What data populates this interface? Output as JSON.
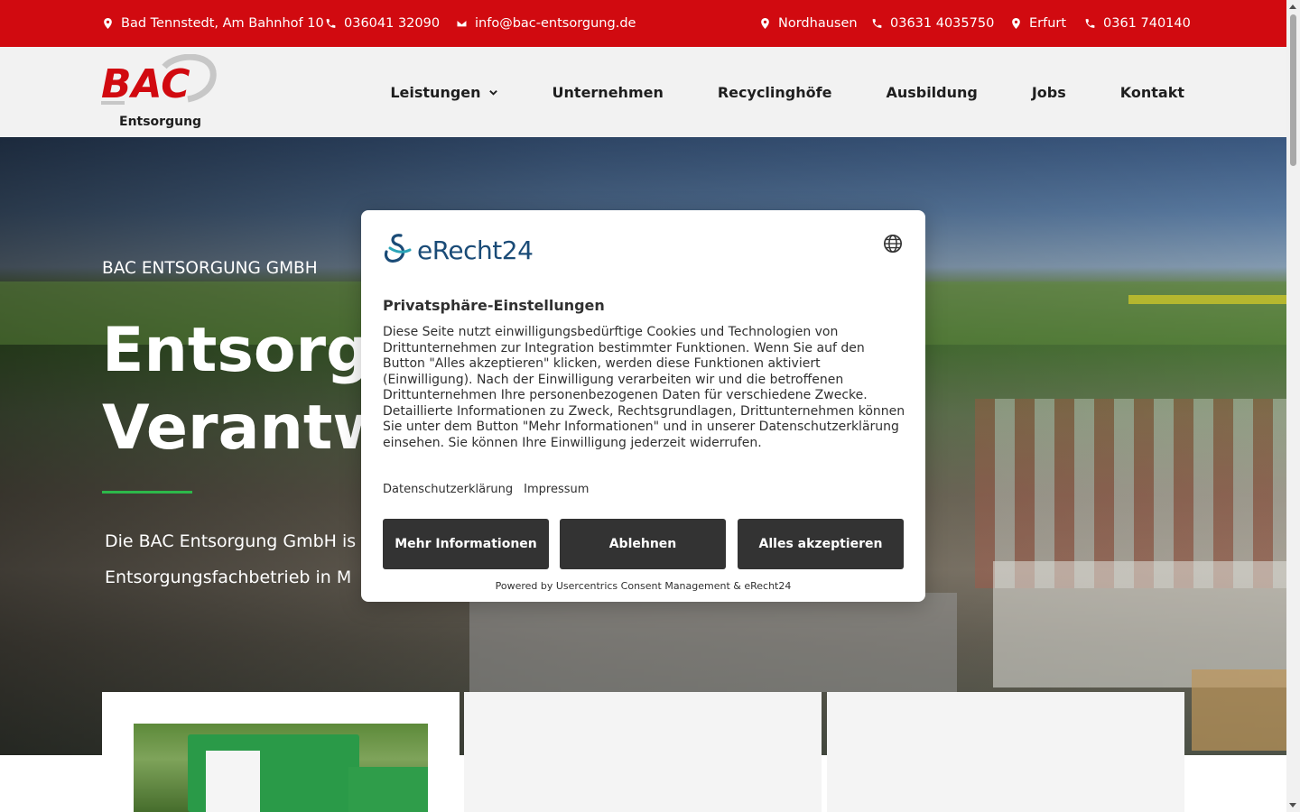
{
  "topbar": {
    "items": [
      {
        "icon": "map-pin-icon",
        "text": "Bad Tennstedt, Am Bahnhof 10"
      },
      {
        "icon": "phone-icon",
        "text": "036041 32090"
      },
      {
        "icon": "mail-icon",
        "text": "info@bac-entsorgung.de"
      },
      {
        "icon": "map-pin-icon",
        "text": "Nordhausen"
      },
      {
        "icon": "phone-icon",
        "text": "03631 4035750"
      },
      {
        "icon": "map-pin-icon",
        "text": "Erfurt"
      },
      {
        "icon": "phone-icon",
        "text": "0361 740140"
      }
    ]
  },
  "logo": {
    "brand": "BAC",
    "subtitle": "Entsorgung"
  },
  "nav": {
    "items": [
      {
        "label": "Leistungen",
        "has_dropdown": true
      },
      {
        "label": "Unternehmen"
      },
      {
        "label": "Recyclinghöfe"
      },
      {
        "label": "Ausbildung"
      },
      {
        "label": "Jobs"
      },
      {
        "label": "Kontakt"
      }
    ]
  },
  "hero": {
    "kicker": "BAC ENTSORGUNG GMBH",
    "headline_line1": "Entsorgu",
    "headline_line2": "Verantwo",
    "lead_line1": "Die BAC Entsorgung GmbH is",
    "lead_line2": "Entsorgungsfachbetrieb in M"
  },
  "consent": {
    "brand": "eRecht24",
    "title": "Privatsphäre-Einstellungen",
    "text": "Diese Seite nutzt einwilligungsbedürftige Cookies und Technologien von Drittunternehmen zur Integration bestimmter Funktionen. Wenn Sie auf den Button \"Alles akzeptieren\" klicken, werden diese Funktionen aktiviert (Einwilligung). Nach der Einwilligung verarbeiten wir und die betroffenen Drittunternehmen Ihre personenbezogenen Daten für verschiedene Zwecke. Detaillierte Informationen zu Zweck, Rechtsgrundlagen, Drittunternehmen können Sie unter dem Button \"Mehr Informationen\" und in unserer Datenschutzerklärung einsehen. Sie können Ihre Einwilligung jederzeit widerrufen.",
    "links": [
      "Datenschutzerklärung",
      "Impressum"
    ],
    "btn_more": "Mehr Informationen",
    "btn_decline": "Ablehnen",
    "btn_accept": "Alles akzeptieren",
    "powered": "Powered by Usercentrics Consent Management & eRecht24"
  },
  "colors": {
    "brand_red": "#d10a10",
    "accent_green": "#2db84a",
    "button_dark": "#333333",
    "erecht_blue": "#1a4b77"
  }
}
